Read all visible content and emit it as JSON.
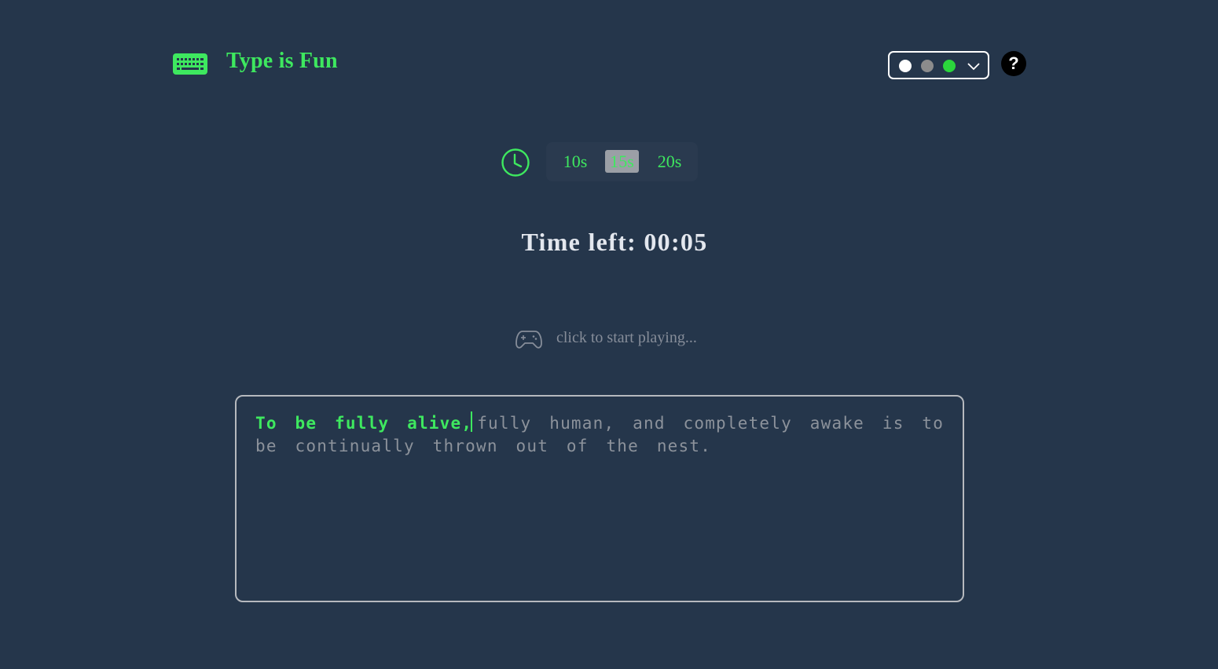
{
  "header": {
    "title": "Type is Fun",
    "theme_colors": [
      "#ffffff",
      "#8c8c8c",
      "#2bd63c"
    ],
    "help_label": "?"
  },
  "timer": {
    "options": [
      "10s",
      "15s",
      "20s"
    ],
    "selected": "15s",
    "time_left": "Time left: 00:05"
  },
  "start": {
    "prompt": "click to start playing..."
  },
  "typing": {
    "typed_text": "To be fully alive,",
    "remaining_text": "fully human, and completely awake is to be continually thrown out of the nest."
  },
  "colors": {
    "background": "#25364b",
    "accent": "#3ee85f",
    "muted_text": "#8c929b"
  }
}
